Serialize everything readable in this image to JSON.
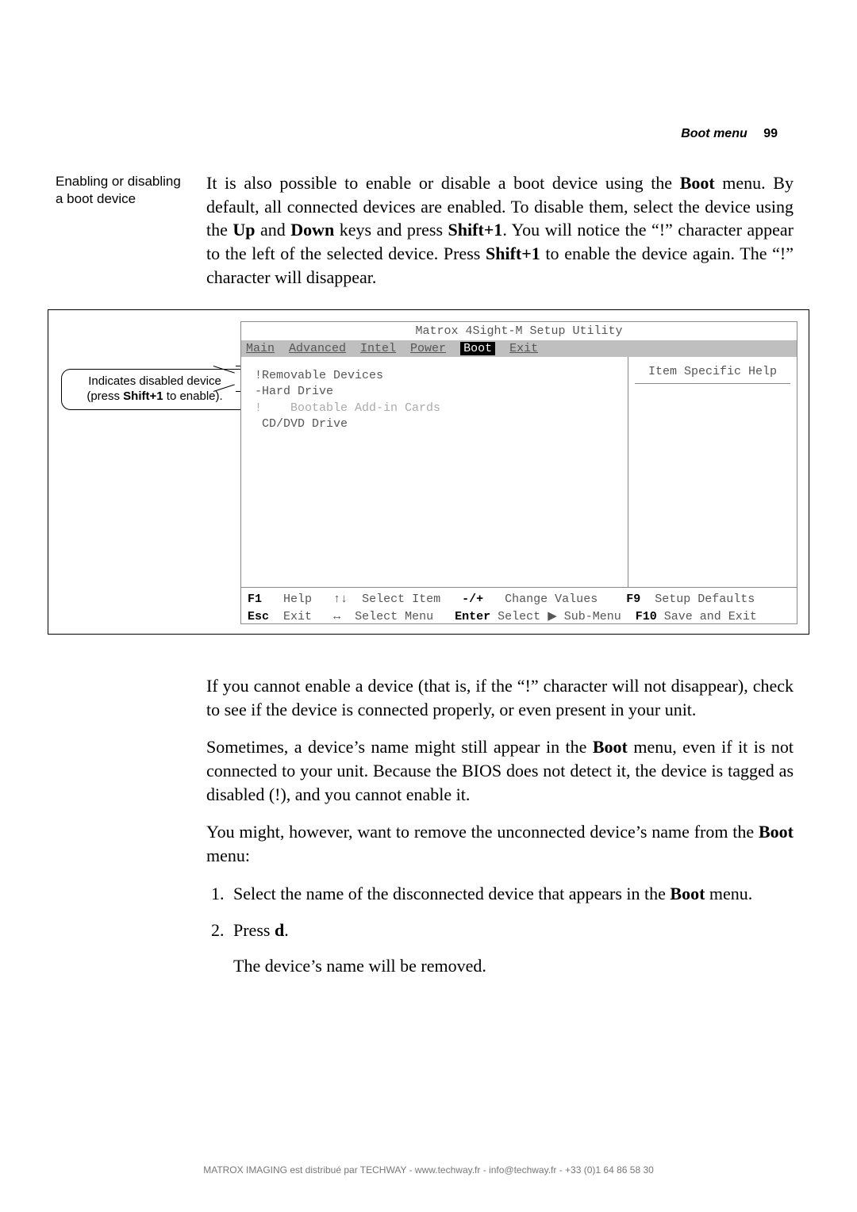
{
  "header": {
    "section": "Boot menu",
    "page": "99"
  },
  "sidenote": "Enabling or disabling a boot device",
  "intro": {
    "t1": "It is also possible to enable or disable a boot device using the ",
    "b1": "Boot",
    "t2": " menu. By default, all connected devices are enabled. To disable them, select the device using the ",
    "b2": "Up",
    "t3": " and ",
    "b3": "Down",
    "t4": " keys and press ",
    "b4": "Shift+1",
    "t5": ". You will notice the “!” character appear to the left of the selected device. Press ",
    "b5": "Shift+1",
    "t6": " to enable the device again. The “!” character will disappear."
  },
  "callout": {
    "l1": "Indicates disabled device",
    "l2a": "(press ",
    "l2b": "Shift+1",
    "l2c": " to enable)."
  },
  "bios": {
    "title": "Matrox 4Sight-M Setup Utility",
    "tabs": {
      "main": "Main",
      "adv": "Advanced",
      "intel": "Intel",
      "power": "Power",
      "boot": "Boot",
      "exit": "Exit"
    },
    "list": {
      "l1": " !Removable Devices",
      "l2": " -Hard Drive",
      "l3": " !    Bootable Add-in Cards",
      "l4": "  CD/DVD Drive"
    },
    "help": "Item Specific Help",
    "footer": {
      "r1": {
        "k1": "F1",
        "v1": "Help",
        "a1": "↑↓",
        "v2": "Select Item",
        "k2": "-/+",
        "v3": "Change Values",
        "k3": "F9",
        "v4": "Setup Defaults"
      },
      "r2": {
        "k1": "Esc",
        "v1": "Exit",
        "a1": "↔",
        "v2": "Select Menu",
        "k2": "Enter",
        "v3a": "Select ",
        "tri": "▶",
        "v3b": " Sub-Menu",
        "k3": "F10",
        "v4": "Save and Exit"
      }
    }
  },
  "after": {
    "p1": "If you cannot enable a device (that is, if the “!” character will not disappear), check to see if the device is connected properly, or even present in your unit.",
    "p2a": "Sometimes, a device’s name might still appear in the ",
    "p2b": "Boot",
    "p2c": " menu, even if it is not connected to your unit. Because the BIOS does not detect it, the device is tagged as disabled (!), and you cannot enable it.",
    "p3a": "You might, however, want to remove the unconnected device’s name from the ",
    "p3b": "Boot",
    "p3c": " menu:",
    "li1a": "Select the name of the disconnected device that appears in the ",
    "li1b": "Boot",
    "li1c": " menu.",
    "li2a": "Press ",
    "li2b": "d",
    "li2c": ".",
    "p4": "The device’s name will be removed."
  },
  "distribution": "MATROX IMAGING est distribué par TECHWAY - www.techway.fr - info@techway.fr - +33 (0)1 64 86 58 30"
}
